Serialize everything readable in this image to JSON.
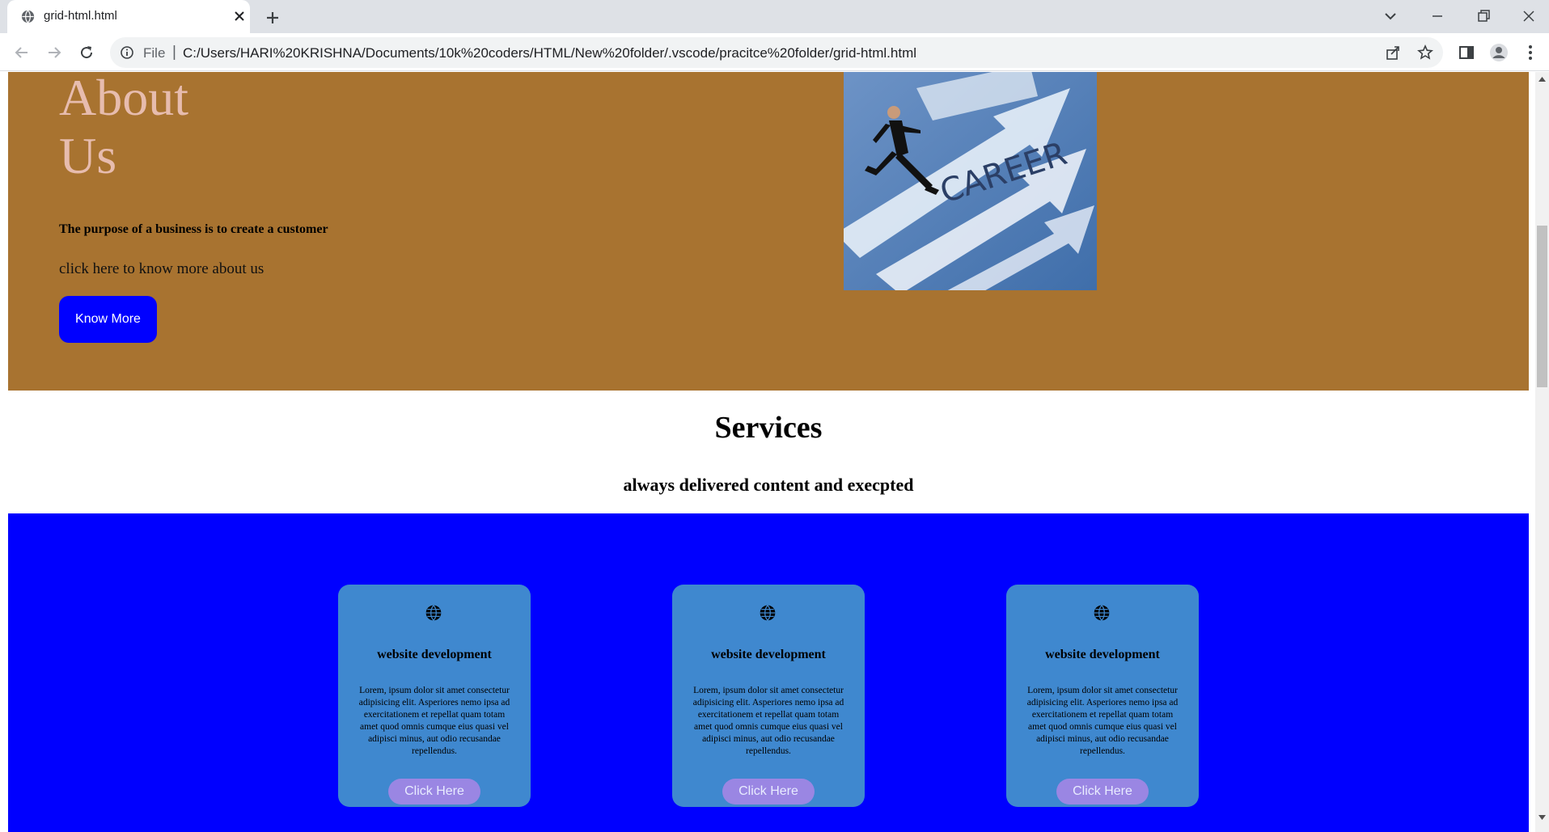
{
  "browser": {
    "tab_title": "grid-html.html",
    "omnibox_label": "File",
    "omnibox_separator": "|",
    "url": "C:/Users/HARI%20KRISHNA/Documents/10k%20coders/HTML/New%20folder/.vscode/pracitce%20folder/grid-html.html"
  },
  "about": {
    "heading": "About Us",
    "tagline": "The purpose of a business is to create a customer",
    "link_text": "click here to know more about us",
    "button_label": "Know More",
    "image_word": "CAREER"
  },
  "services": {
    "title": "Services",
    "subtitle": "always delivered content and execpted",
    "cards": [
      {
        "title": "website development",
        "text": "Lorem, ipsum dolor sit amet consectetur adipisicing elit. Asperiores nemo ipsa ad exercitationem et repellat quam totam amet quod omnis cumque eius quasi vel adipisci minus, aut odio recusandae repellendus.",
        "button_label": "Click Here"
      },
      {
        "title": "website development",
        "text": "Lorem, ipsum dolor sit amet consectetur adipisicing elit. Asperiores nemo ipsa ad exercitationem et repellat quam totam amet quod omnis cumque eius quasi vel adipisci minus, aut odio recusandae repellendus.",
        "button_label": "Click Here"
      },
      {
        "title": "website development",
        "text": "Lorem, ipsum dolor sit amet consectetur adipisicing elit. Asperiores nemo ipsa ad exercitationem et repellat quam totam amet quod omnis cumque eius quasi vel adipisci minus, aut odio recusandae repellendus.",
        "button_label": "Click Here"
      }
    ]
  },
  "colors": {
    "about_bg": "#a87330",
    "heading": "#e7bcae",
    "primary_button": "#0000ff",
    "services_band": "#0000ff",
    "card_bg": "#3f88cf",
    "card_button": "#9a86e3"
  }
}
